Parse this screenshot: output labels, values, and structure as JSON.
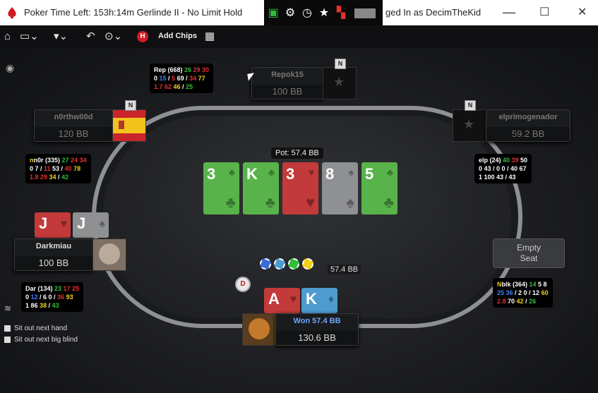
{
  "window": {
    "title_left": "Poker Time Left: 153h:14m Gerlinde II - No Limit Hold",
    "title_right": "ged In as DecimTheKid",
    "minimize": "—",
    "maximize": "☐",
    "close": "✕"
  },
  "toolbar": {
    "add_chips_label": "Add Chips",
    "red_badge": "H"
  },
  "table": {
    "pot_label": "Pot: 57.4 BB",
    "chips_amount": "57.4 BB",
    "dealer_label": "D"
  },
  "board": [
    {
      "rank": "3",
      "suit": "♣",
      "color": "#58b44a"
    },
    {
      "rank": "K",
      "suit": "♣",
      "color": "#58b44a"
    },
    {
      "rank": "3",
      "suit": "♥",
      "color": "#c33a3a"
    },
    {
      "rank": "8",
      "suit": "♠",
      "color": "#8f9092"
    },
    {
      "rank": "5",
      "suit": "♣",
      "color": "#58b44a"
    }
  ],
  "seats": {
    "top": {
      "name": "Repok15",
      "stack": "100 BB",
      "badge": "N"
    },
    "left_top": {
      "name": "n0rthw00d",
      "stack": "120 BB",
      "badge": "N"
    },
    "right_top": {
      "name": "elprimogenador",
      "stack": "59.2 BB",
      "badge": "N"
    },
    "left_mid": {
      "name": "Darkmiau",
      "stack": "100 BB",
      "cards": [
        "J",
        "J"
      ]
    },
    "right_mid": {
      "label_line1": "Empty",
      "label_line2": "Seat"
    },
    "hero": {
      "name": "Won 57.4 BB",
      "stack": "130.6 BB",
      "cards": [
        "A",
        "K"
      ]
    }
  },
  "huds": {
    "top": {
      "line1": [
        [
          "w",
          "Rep (668) "
        ],
        [
          "g",
          "26 "
        ],
        [
          "r",
          "29 "
        ],
        [
          "r",
          "30"
        ]
      ],
      "line2": [
        [
          "w",
          "0 "
        ],
        [
          "b",
          "15"
        ],
        [
          "w",
          " / "
        ],
        [
          "r",
          "5 "
        ],
        [
          "w",
          "69 / "
        ],
        [
          "r",
          "34 "
        ],
        [
          "y",
          "77"
        ]
      ],
      "line3": [
        [
          "r",
          "1.7 "
        ],
        [
          "r",
          "62 "
        ],
        [
          "y",
          "46"
        ],
        [
          "w",
          " / "
        ],
        [
          "g",
          "25"
        ]
      ]
    },
    "left_top": {
      "line1": [
        [
          "y",
          "n"
        ],
        [
          "w",
          "n0r (335) "
        ],
        [
          "g",
          "27 "
        ],
        [
          "r",
          "24 "
        ],
        [
          "r",
          "34"
        ]
      ],
      "line2": [
        [
          "w",
          "0 7 / "
        ],
        [
          "r",
          "11 "
        ],
        [
          "w",
          "53 / "
        ],
        [
          "r",
          "40 "
        ],
        [
          "y",
          "78"
        ]
      ],
      "line3": [
        [
          "r",
          "1.8 "
        ],
        [
          "r",
          "29 "
        ],
        [
          "y",
          "34"
        ],
        [
          "w",
          " / "
        ],
        [
          "g",
          "42"
        ]
      ]
    },
    "right_top": {
      "line1": [
        [
          "w",
          "elp (24) "
        ],
        [
          "g",
          "40 "
        ],
        [
          "r",
          "39 "
        ],
        [
          "w",
          "50"
        ]
      ],
      "line2": [
        [
          "w",
          "0 43 / 0 0 / 40 67"
        ]
      ],
      "line3": [
        [
          "w",
          "1 100 43 / 43"
        ]
      ]
    },
    "left_bottom": {
      "line1": [
        [
          "w",
          "Dar (134) "
        ],
        [
          "g",
          "23 "
        ],
        [
          "r",
          "17 "
        ],
        [
          "r",
          "25"
        ]
      ],
      "line2": [
        [
          "w",
          "0 "
        ],
        [
          "b",
          "12"
        ],
        [
          "w",
          " / 6 0 / "
        ],
        [
          "r",
          "36 "
        ],
        [
          "y",
          "93"
        ]
      ],
      "line3": [
        [
          "w",
          "1 86 "
        ],
        [
          "y",
          "38"
        ],
        [
          "w",
          " / "
        ],
        [
          "g",
          "43"
        ]
      ]
    },
    "right_bottom": {
      "line1": [
        [
          "y",
          "N"
        ],
        [
          "w",
          "blk (364) "
        ],
        [
          "g",
          "14 "
        ],
        [
          "w",
          "5 8"
        ]
      ],
      "line2": [
        [
          "b",
          "25 "
        ],
        [
          "b",
          "36"
        ],
        [
          "w",
          " / 2 0 / 12 "
        ],
        [
          "y",
          "60"
        ]
      ],
      "line3": [
        [
          "r",
          "2.8 "
        ],
        [
          "w",
          "70 "
        ],
        [
          "y",
          "42"
        ],
        [
          "w",
          " / "
        ],
        [
          "g",
          "26"
        ]
      ]
    }
  },
  "options": {
    "sit_out_next_hand": "Sit out next hand",
    "sit_out_next_bb": "Sit out next big blind"
  },
  "colors": {
    "green_card": "#58b44a",
    "red_card": "#c33a3a",
    "gray_card": "#8f9092",
    "blue_card": "#4e9bd0",
    "brand_red": "#d11b24"
  }
}
